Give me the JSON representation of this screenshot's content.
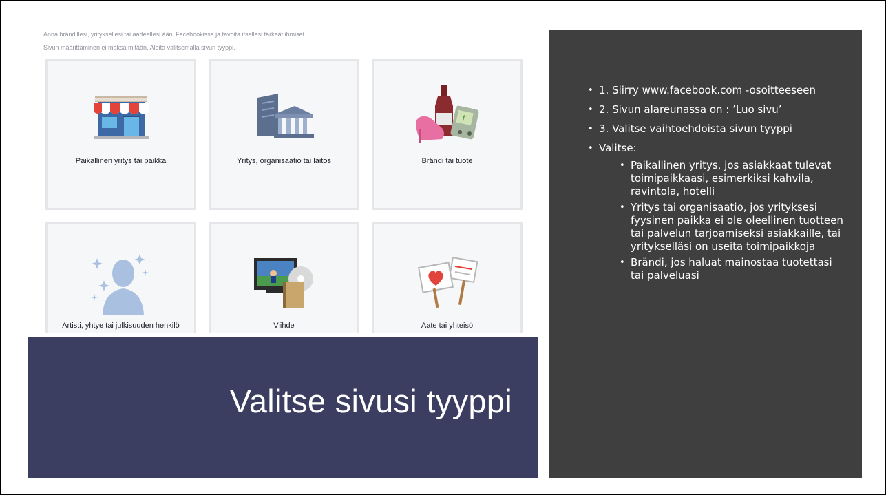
{
  "facebook": {
    "intro_line1": "Anna brändillesi, yrityksellesi tai aatteellesi ääni Facebookissa ja tavoita itsellesi tärkeät ihmiset.",
    "intro_line2": "Sivun määrittäminen ei maksa mitään. Aloita valitsemalla sivun tyyppi.",
    "tiles": [
      {
        "label": "Paikallinen yritys tai paikka",
        "icon": "storefront-icon"
      },
      {
        "label": "Yritys, organisaatio tai laitos",
        "icon": "buildings-icon"
      },
      {
        "label": "Brändi tai tuote",
        "icon": "products-icon"
      },
      {
        "label": "Artisti, yhtye tai julkisuuden henkilö",
        "icon": "person-silhouette-icon"
      },
      {
        "label": "Viihde",
        "icon": "tv-media-icon"
      },
      {
        "label": "Aate tai yhteisö",
        "icon": "protest-signs-icon"
      }
    ]
  },
  "title": "Valitse sivusi tyyppi",
  "bullets": [
    "1. Siirry www.facebook.com -osoitteeseen",
    "2. Sivun alareunassa on : ’Luo sivu’",
    "3. Valitse vaihtoehdoista sivun tyyppi",
    "Valitse:"
  ],
  "sub_bullets": [
    "Paikallinen yritys, jos asiakkaat tulevat toimipaikkaasi, esimerkiksi kahvila, ravintola, hotelli",
    "Yritys tai organisaatio, jos yrityksesi fyysinen paikka ei ole oleellinen tuotteen tai palvelun tarjoamiseksi asiakkaille, tai yritykselläsi on useita toimipaikkoja",
    "Brändi, jos haluat mainostaa tuotettasi tai palveluasi"
  ],
  "bullet_glyph": "•",
  "colors": {
    "title_box": "#3b3d61",
    "panel": "#3f3f3f",
    "tile_bg": "#f6f7f9",
    "tile_border": "#e5e6e9"
  }
}
